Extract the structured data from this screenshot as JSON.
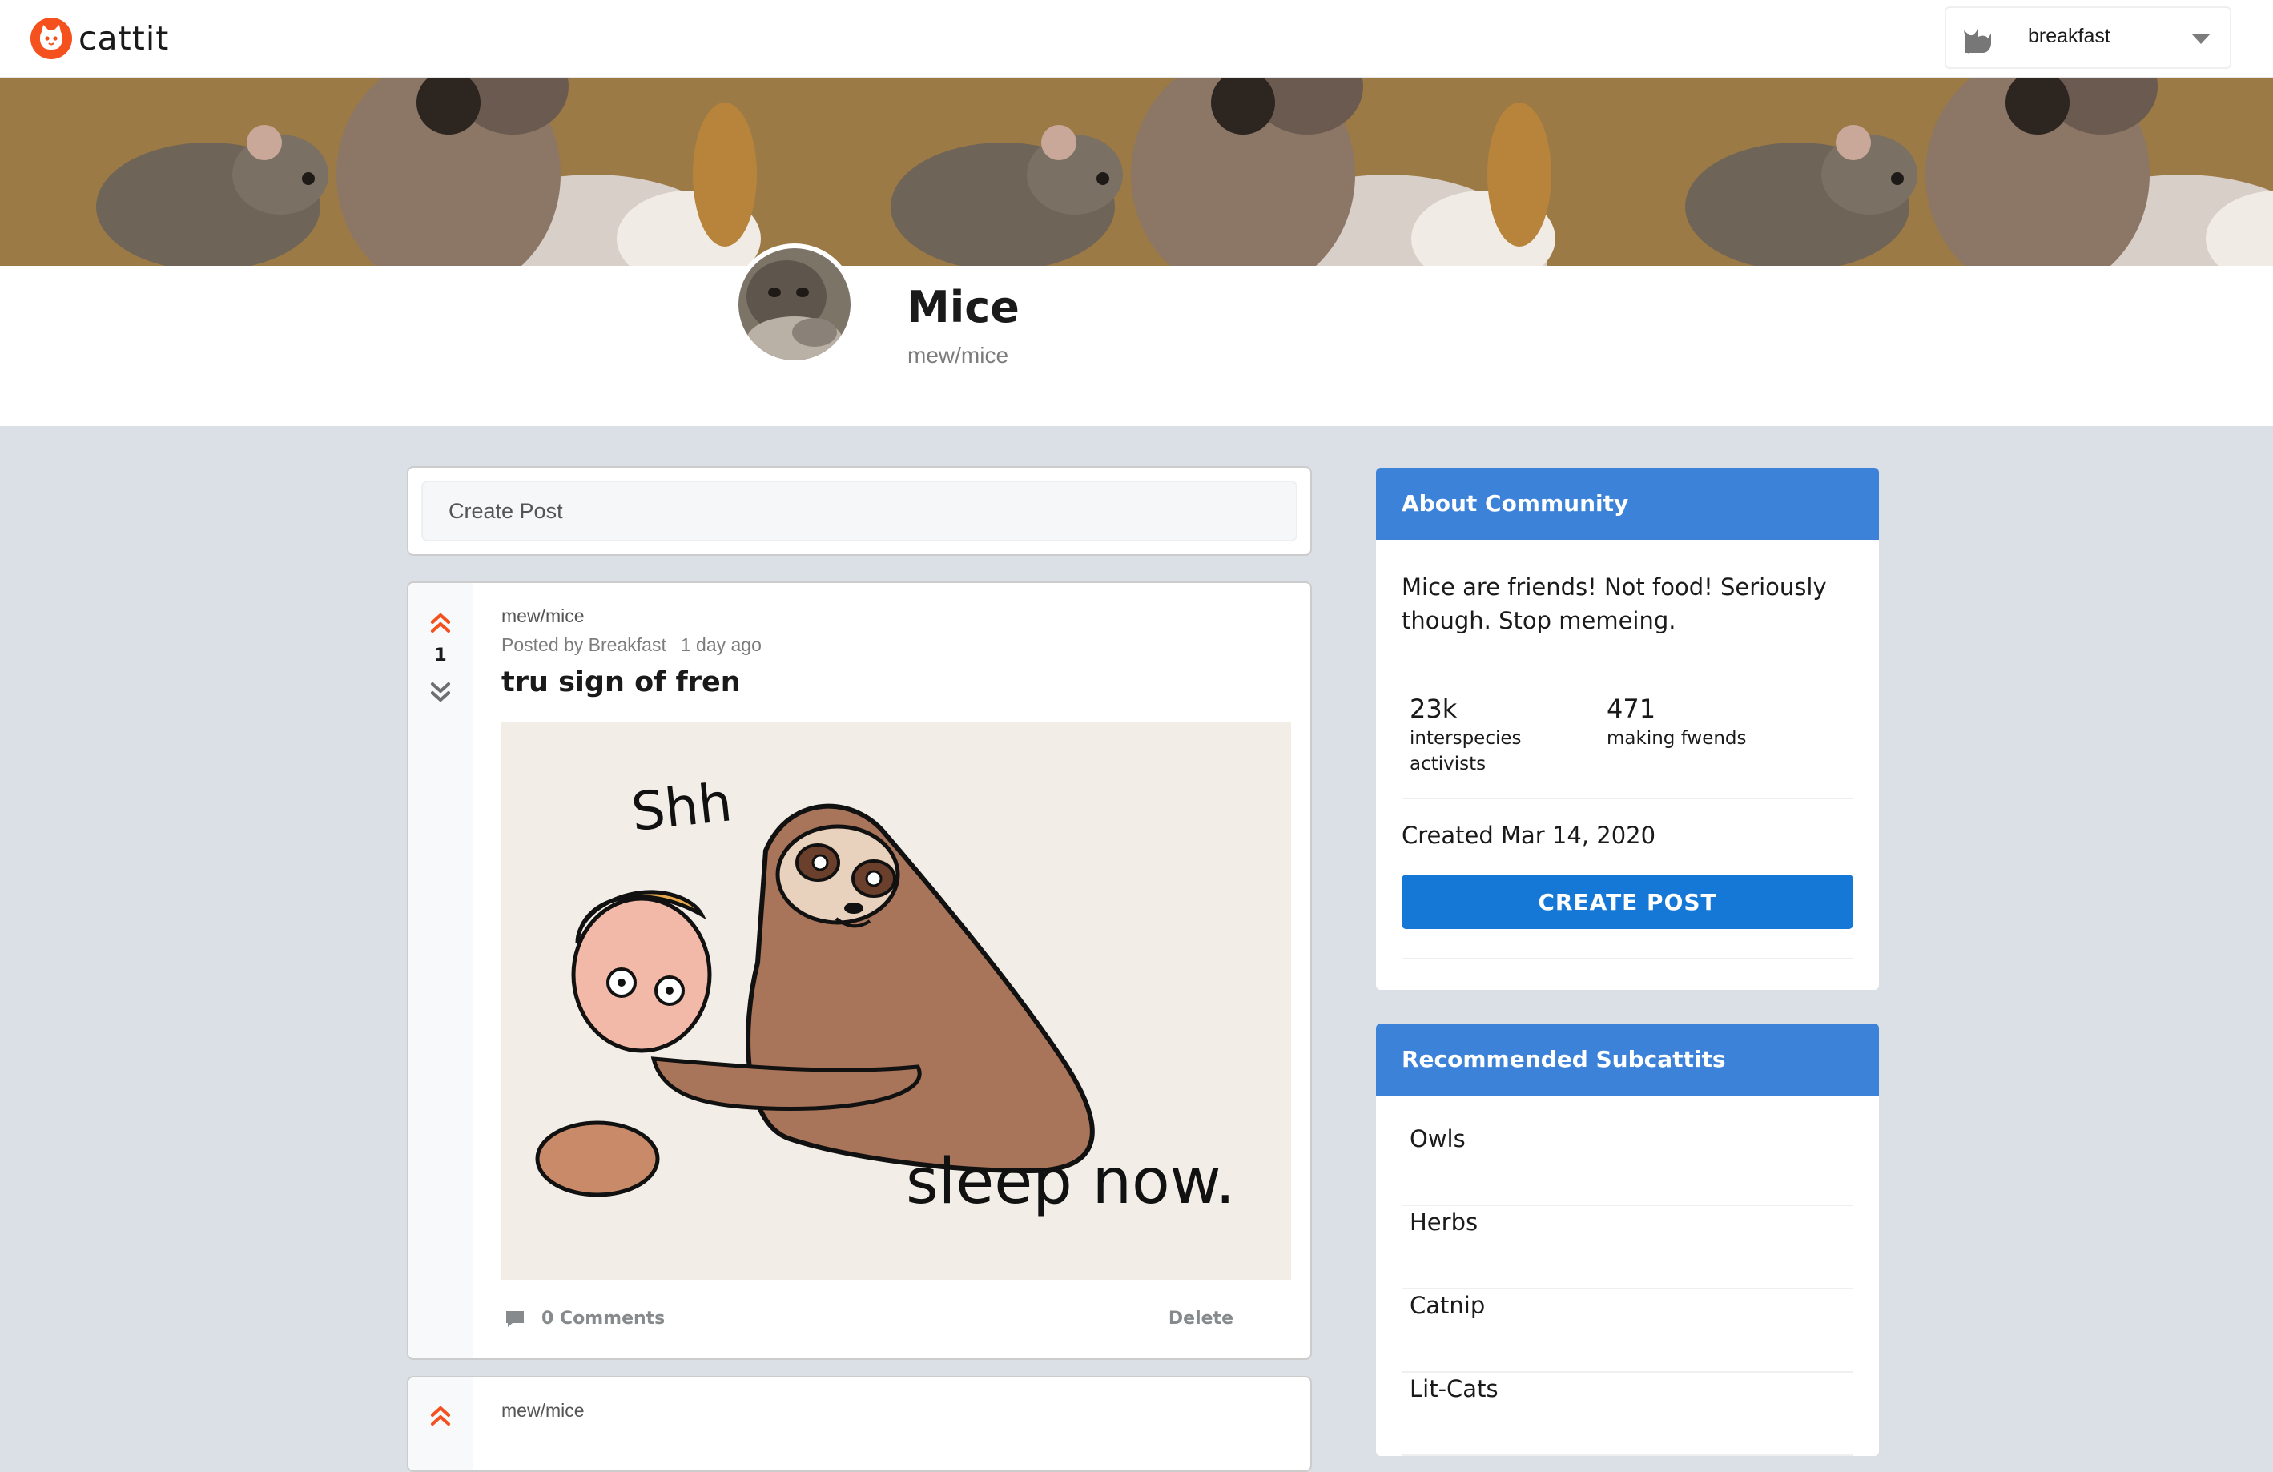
{
  "app": {
    "name": "cattit",
    "logo_icon": "cat-face-icon",
    "brand_color": "#f4511e"
  },
  "user_menu": {
    "username": "breakfast",
    "avatar_icon": "cat-silhouette-icon"
  },
  "community": {
    "title": "Mice",
    "handle": "mew/mice"
  },
  "create_post_bar": {
    "placeholder": "Create Post"
  },
  "posts": [
    {
      "subcattit": "mew/mice",
      "posted_by": "Posted by Breakfast",
      "time": "1 day ago",
      "votes": "1",
      "title": "tru sign of fren",
      "image_text": [
        "Shh",
        "sleep now."
      ],
      "comments": "0 Comments",
      "delete_label": "Delete"
    },
    {
      "subcattit": "mew/mice"
    }
  ],
  "about": {
    "header": "About Community",
    "description": "Mice are friends! Not food! Seriously though. Stop memeing.",
    "stats": [
      {
        "value": "23k",
        "label": "interspecies activists"
      },
      {
        "value": "471",
        "label": "making fwends"
      }
    ],
    "created": "Created Mar 14, 2020",
    "create_button": "CREATE POST",
    "accent_color": "#3b82d8",
    "button_color": "#1678d6"
  },
  "recommended": {
    "header": "Recommended Subcattits",
    "items": [
      "Owls",
      "Herbs",
      "Catnip",
      "Lit-Cats"
    ]
  }
}
